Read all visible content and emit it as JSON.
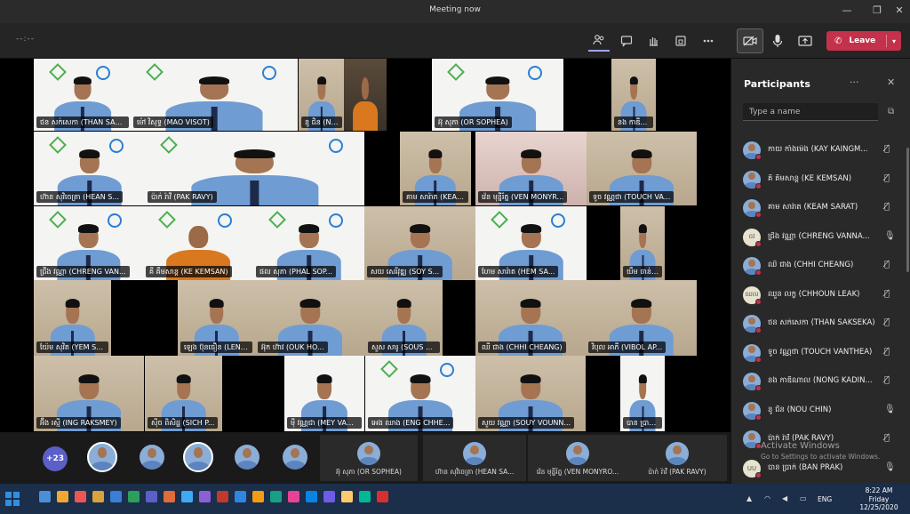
{
  "window": {
    "title": "Meeting now",
    "minimize": "—",
    "maximize": "❐",
    "close": "✕"
  },
  "toolbar": {
    "timer": "--:--",
    "leave_label": "Leave",
    "leave_chevron": "▾"
  },
  "tiles": [
    {
      "name": "ថន សក់សេកា (THAN SAKSEKA)"
    },
    {
      "name": "ម៉ៅ វិសុទ្ធ (MAO VISOT)"
    },
    {
      "name": "នូ ជិន (NOU CHIN)"
    },
    {
      "name": "អ៊ុ សុភា (OR SOPHEA)"
    },
    {
      "name": "នង កាឌីណាល (NONG KADINAL)"
    },
    {
      "name": "ហ៊ាន សុវិចេត្រា (HEAN S..."
    },
    {
      "name": "ប៉ាក់ រ៉ាវី (PAK RAVY)"
    },
    {
      "name": "គាម សារ៉ាត (KEAM SAR..."
    },
    {
      "name": "វ៉េន មុន្នីរ័ត្ន (VEN MONYR..."
    },
    {
      "name": "ទូច វណ្ណថា (TOUCH VA..."
    },
    {
      "name": "ជ្រឹង វណ្ណា (CHRENG VAN..."
    },
    {
      "name": "គី គឹមសាន្ត (KE KEMSAN)"
    },
    {
      "name": "ផល សុភា (PHAL SOP..."
    },
    {
      "name": "សយ សេរីវុឌ្ឍ (SOY S..."
    },
    {
      "name": "ហែម សារ៉ាត (HEM SA..."
    },
    {
      "name": "យឹម ចាន់ថា (YIM CHANT..."
    },
    {
      "name": "យ៉ែម សុវិត (YEM SOVIT..."
    },
    {
      "name": "ឡេង ប៊ុនធឿន (LENG B..."
    },
    {
      "name": "អ៊ុក ហ៊ាវ (OUK HO..."
    },
    {
      "name": "សួស សារូ (SOUS SARU)"
    },
    {
      "name": "ឈី ជាង (CHHI CHEANG)"
    },
    {
      "name": "វិបុល អាភី (VIBOL AP..."
    },
    {
      "name": "អ៊ឹង រស្មី (ING RAKSMEY)"
    },
    {
      "name": "ស៊ីច ពិសិដ្ឋ (SICH P..."
    },
    {
      "name": "ម៉ី វណ្ណជា (MEY VANNCHEA)"
    },
    {
      "name": "អេង ឈាង (ENG CHHE..."
    },
    {
      "name": "សួយ វណ្ណា (SOUY VOUNN..."
    },
    {
      "name": "បាន ប្រាក់ (BAN PRAK)"
    },
    {
      "name": "CHHOUN LEAK"
    }
  ],
  "strip": {
    "count": "+23",
    "tiles": [
      {
        "name": "អ៊ុ សុភា (OR SOPHEA)"
      },
      {
        "name": "ហ៊ាន សុវិចេត្រា (HEAN SA..."
      },
      {
        "name": "វ៉េន មុន្នីរ័ត្ន (VEN MONYRO..."
      },
      {
        "name": "ប៉ាក់ រ៉ាវី (PAK RAVY)"
      }
    ]
  },
  "panel": {
    "title": "Participants",
    "more": "···",
    "close": "✕",
    "search_placeholder": "Type a name",
    "participants": [
      {
        "name": "កាយ កាំងម៉េង (KAY KAINGM...",
        "mic": "🎙̸"
      },
      {
        "name": "គី គឹមសាន្ត (KE KEMSAN)",
        "mic": "🎙̸"
      },
      {
        "name": "គាម សារ៉ាត (KEAM SARAT)",
        "mic": "🎙̸"
      },
      {
        "name": "ជ្រឹង វណ្ណា (CHRENG VANNA...",
        "mic": "🎙",
        "initials": "ជវ"
      },
      {
        "name": "ឈី ជាង (CHHI CHEANG)",
        "mic": "🎙̸"
      },
      {
        "name": "ឈួន លក្ខ (CHHOUN LEAK)",
        "mic": "🎙̸",
        "initials": "ឈល"
      },
      {
        "name": "ថន សក់សេកា (THAN SAKSEKA)",
        "mic": "🎙̸"
      },
      {
        "name": "ទូច វណ្ណថា (TOUCH VANTHEA)",
        "mic": "🎙̸"
      },
      {
        "name": "នង កាឌីណាល (NONG KADIN...",
        "mic": "🎙̸"
      },
      {
        "name": "នូ ជិន (NOU CHIN)",
        "mic": "🎙"
      },
      {
        "name": "ប៉ាក់ រ៉ាវី (PAK RAVY)",
        "mic": "🎙̸"
      },
      {
        "name": "បាន ប្រាក់ (BAN PRAK)",
        "mic": "🎙",
        "initials": "UU"
      }
    ]
  },
  "watermark": {
    "line1": "Activate Windows",
    "line2": "Go to Settings to activate Windows."
  },
  "taskbar": {
    "time": "8:22 AM",
    "day": "Friday",
    "date": "12/25/2020",
    "lang": "ENG"
  }
}
